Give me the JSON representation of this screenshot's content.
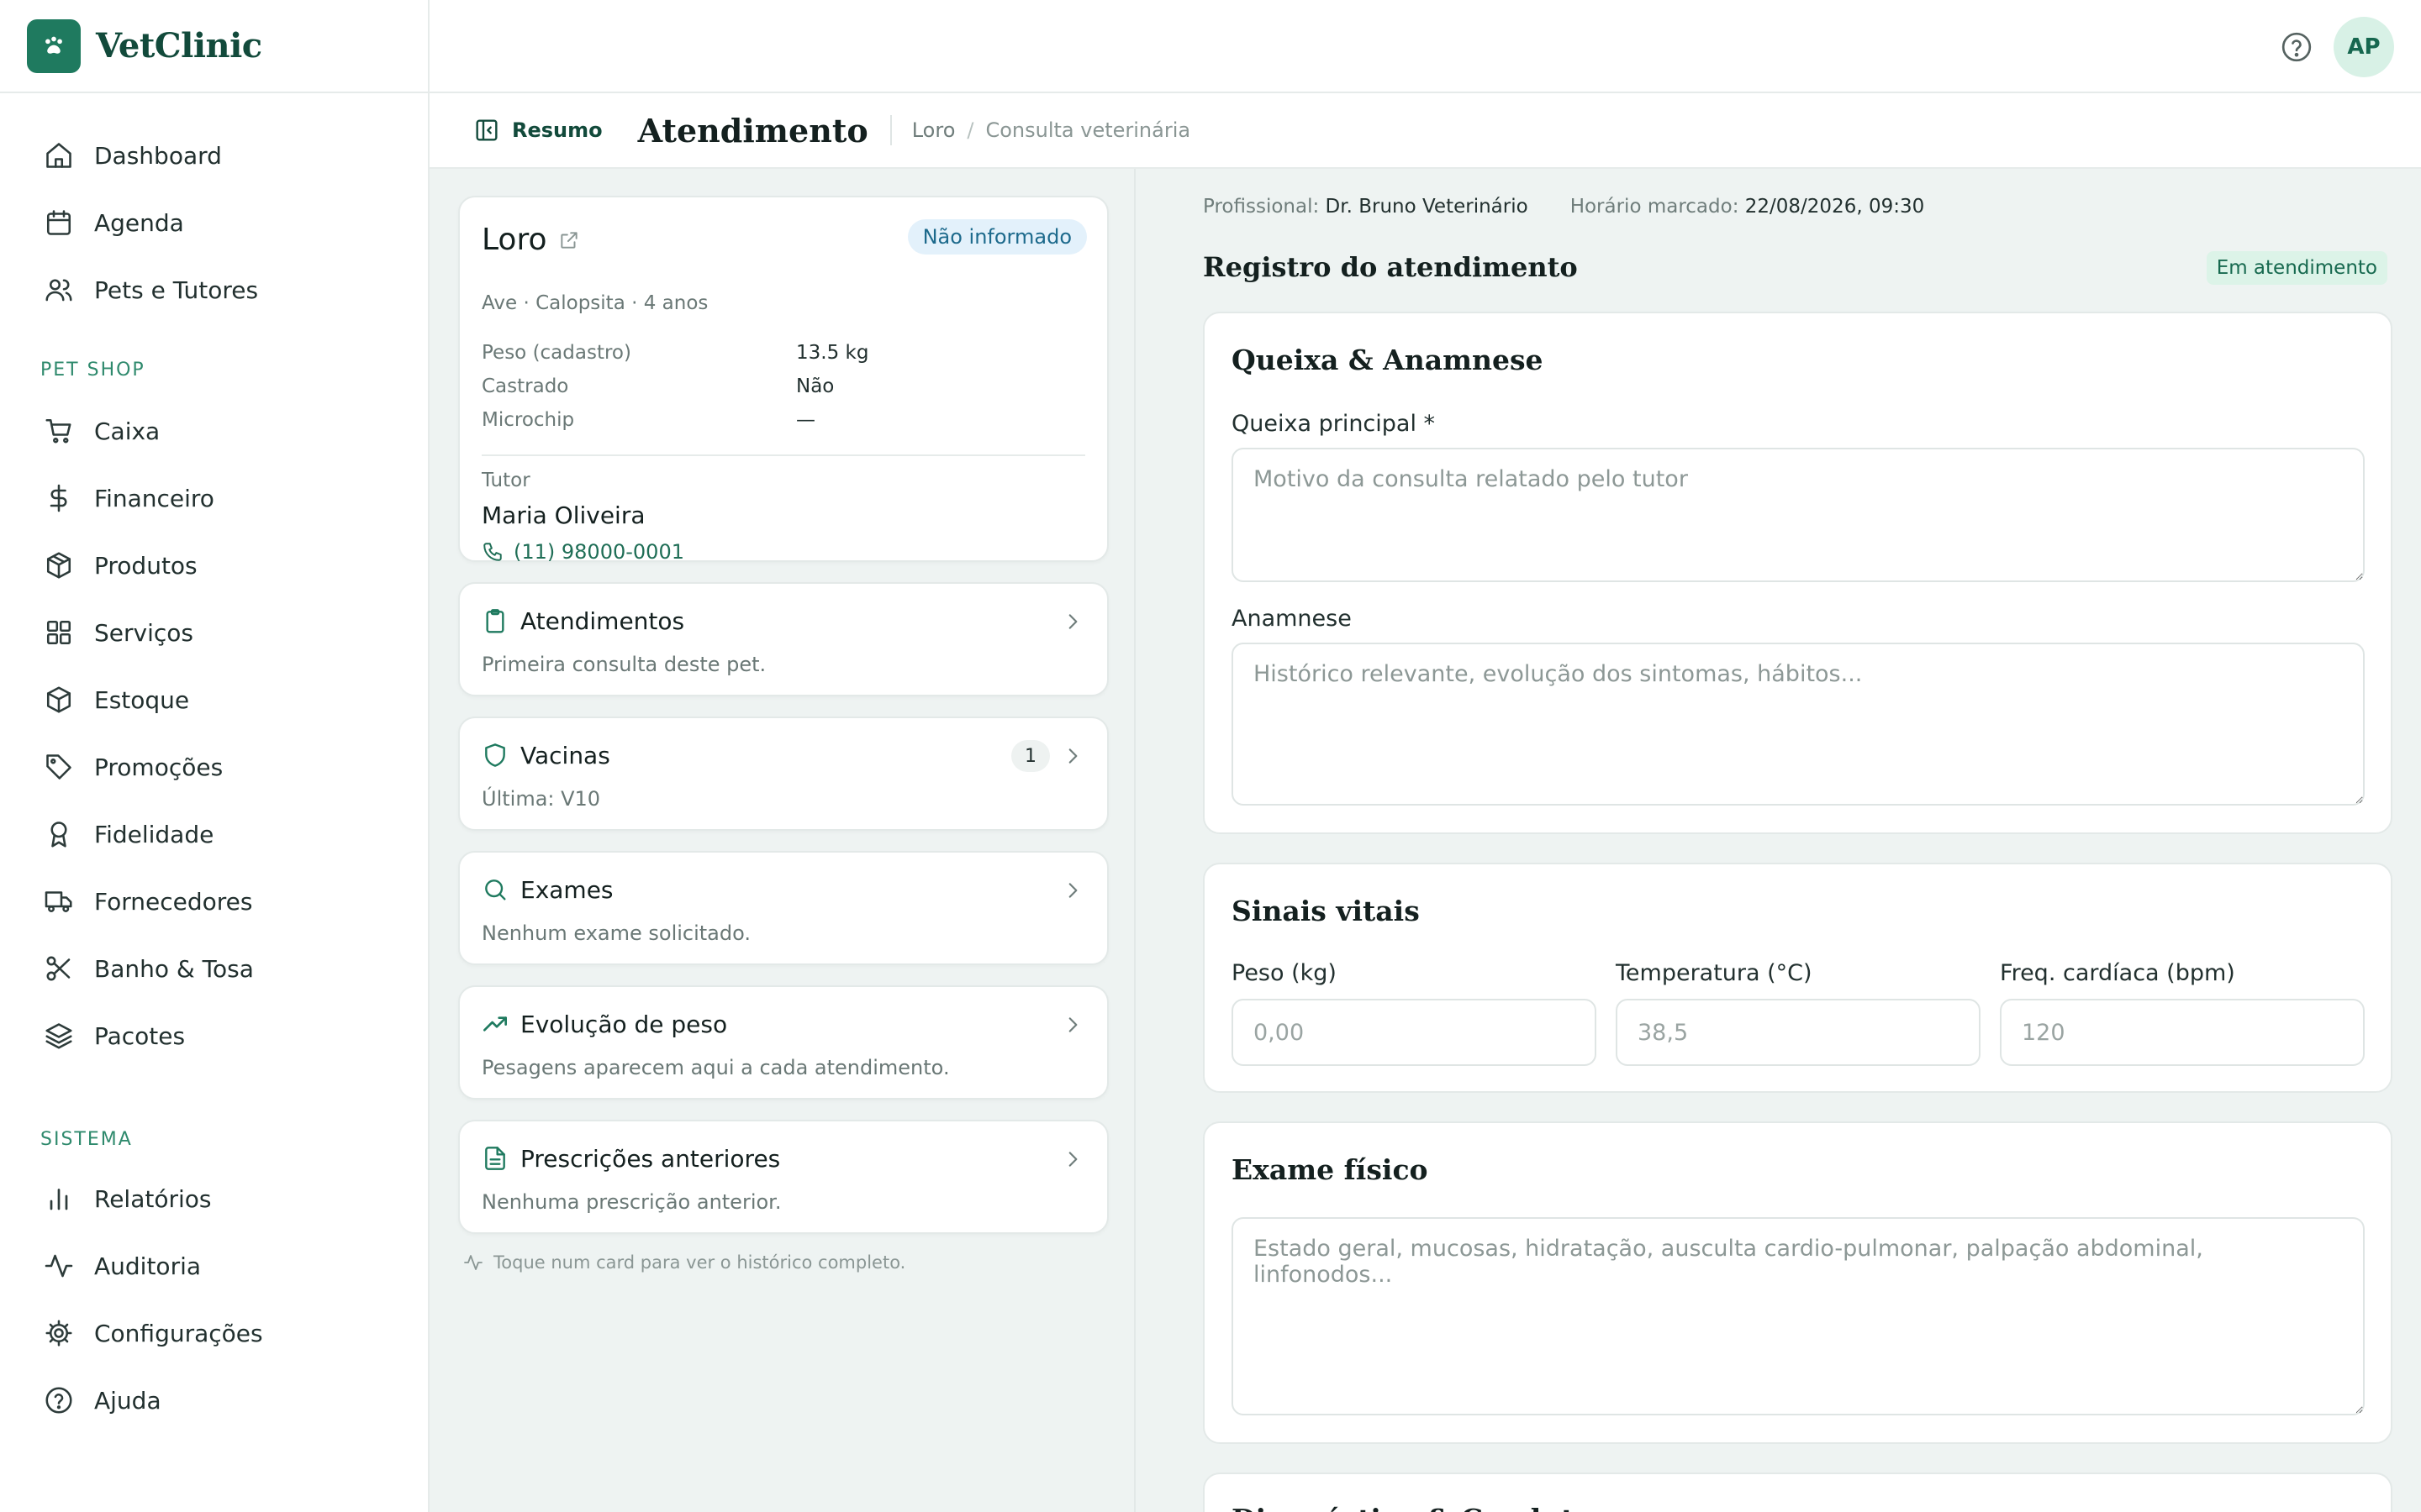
{
  "app": {
    "name": "VetClinic",
    "user_initials": "AP"
  },
  "colors": {
    "brand": "#1f7a5f",
    "accent_text": "#124a3b",
    "badge_blue_bg": "#e3f1fb",
    "badge_green_bg": "#dcf3e8"
  },
  "sidebar": {
    "items": [
      {
        "label": "Dashboard",
        "icon": "home-icon"
      },
      {
        "label": "Agenda",
        "icon": "calendar-icon"
      },
      {
        "label": "Pets e Tutores",
        "icon": "users-icon"
      }
    ],
    "section_petshop": "PET SHOP",
    "petshop_items": [
      {
        "label": "Caixa",
        "icon": "cart-icon"
      },
      {
        "label": "Financeiro",
        "icon": "dollar-icon"
      },
      {
        "label": "Produtos",
        "icon": "box-icon"
      },
      {
        "label": "Serviços",
        "icon": "grid-icon"
      },
      {
        "label": "Estoque",
        "icon": "package-icon"
      },
      {
        "label": "Promoções",
        "icon": "tag-icon"
      },
      {
        "label": "Fidelidade",
        "icon": "award-icon"
      },
      {
        "label": "Fornecedores",
        "icon": "truck-icon"
      },
      {
        "label": "Banho & Tosa",
        "icon": "scissors-icon"
      },
      {
        "label": "Pacotes",
        "icon": "layers-icon"
      }
    ],
    "section_sistema": "SISTEMA",
    "sistema_items": [
      {
        "label": "Relatórios",
        "icon": "bar-chart-icon"
      },
      {
        "label": "Auditoria",
        "icon": "activity-icon"
      },
      {
        "label": "Configurações",
        "icon": "gear-icon"
      },
      {
        "label": "Ajuda",
        "icon": "help-icon"
      }
    ]
  },
  "header": {
    "resumo": "Resumo",
    "title": "Atendimento",
    "breadcrumb": [
      "Loro",
      "Consulta veterinária"
    ]
  },
  "pet": {
    "name": "Loro",
    "badge": "Não informado",
    "subtitle": "Ave · Calopsita · 4 anos",
    "fields": [
      {
        "label": "Peso (cadastro)",
        "value": "13.5 kg"
      },
      {
        "label": "Castrado",
        "value": "Não"
      },
      {
        "label": "Microchip",
        "value": "—"
      }
    ],
    "tutor_label": "Tutor",
    "tutor_name": "Maria Oliveira",
    "tutor_phone": "(11) 98000-0001"
  },
  "history_cards": [
    {
      "title": "Atendimentos",
      "subtitle": "Primeira consulta deste pet.",
      "icon": "clipboard-icon"
    },
    {
      "title": "Vacinas",
      "subtitle": "Última: V10",
      "icon": "shield-icon",
      "count": "1"
    },
    {
      "title": "Exames",
      "subtitle": "Nenhum exame solicitado.",
      "icon": "search-icon"
    },
    {
      "title": "Evolução de peso",
      "subtitle": "Pesagens aparecem aqui a cada atendimento.",
      "icon": "trending-up-icon"
    },
    {
      "title": "Prescrições anteriores",
      "subtitle": "Nenhuma prescrição anterior.",
      "icon": "file-text-icon"
    }
  ],
  "hint": "Toque num card para ver o histórico completo.",
  "appointment": {
    "profissional_label": "Profissional:",
    "profissional": "Dr. Bruno Veterinário",
    "horario_label": "Horário marcado:",
    "horario": "22/08/2026, 09:30",
    "section_title": "Registro do atendimento",
    "status": "Em atendimento"
  },
  "form": {
    "queixa_card_title": "Queixa & Anamnese",
    "queixa_label": "Queixa principal *",
    "queixa_placeholder": "Motivo da consulta relatado pelo tutor",
    "anamnese_label": "Anamnese",
    "anamnese_placeholder": "Histórico relevante, evolução dos sintomas, hábitos...",
    "vitais_title": "Sinais vitais",
    "peso_label": "Peso (kg)",
    "peso_placeholder": "0,00",
    "temp_label": "Temperatura (°C)",
    "temp_placeholder": "38,5",
    "freq_label": "Freq. cardíaca (bpm)",
    "freq_placeholder": "120",
    "exame_title": "Exame físico",
    "exame_placeholder": "Estado geral, mucosas, hidratação, ausculta cardio-pulmonar, palpação abdominal, linfonodos...",
    "next_title": "Diagnóstico & Conduta"
  }
}
